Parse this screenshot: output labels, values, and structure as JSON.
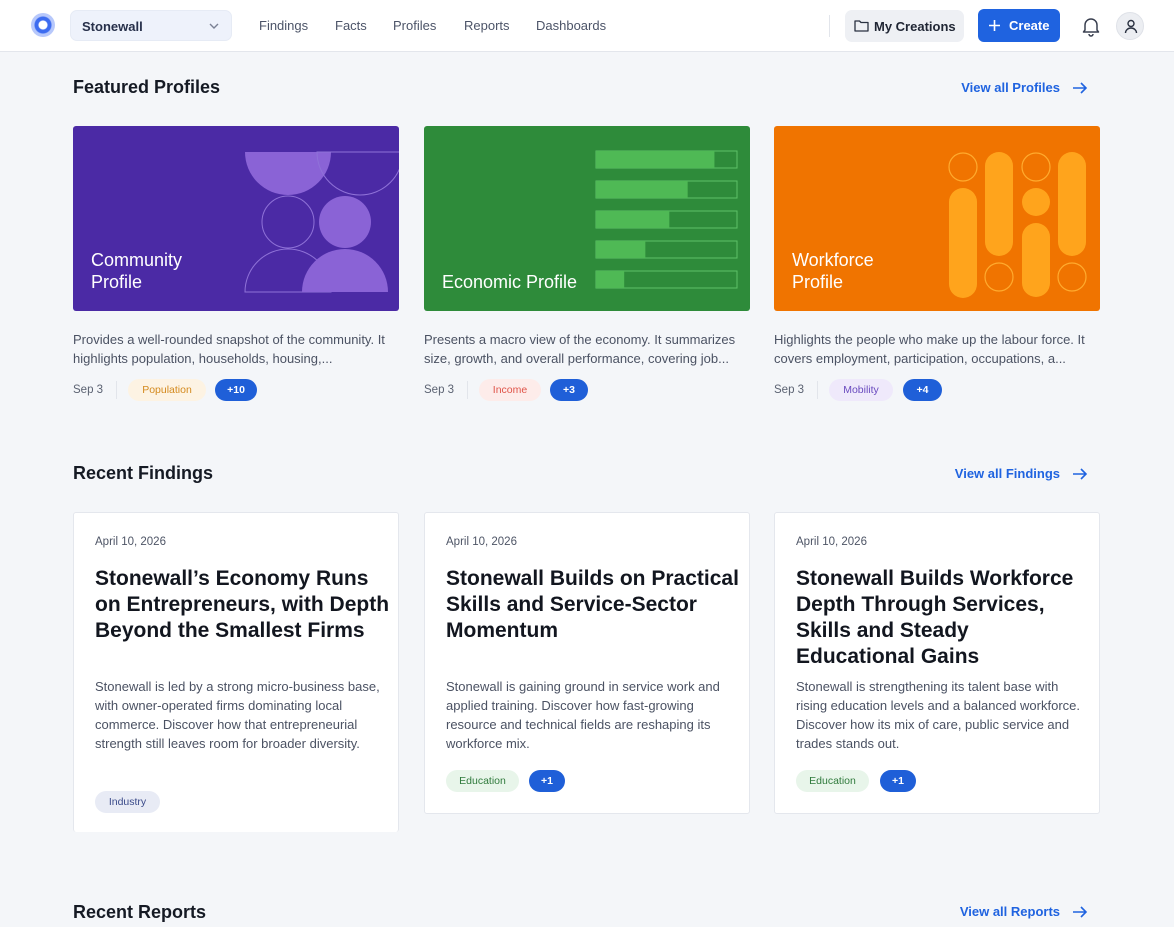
{
  "header": {
    "org_name": "Stonewall",
    "nav": [
      "Findings",
      "Facts",
      "Profiles",
      "Reports",
      "Dashboards"
    ],
    "my_creations_label": "My Creations",
    "create_label": "Create",
    "icons": [
      "logo-icon",
      "chevron-down-icon",
      "folder-icon",
      "plus-icon",
      "bell-icon",
      "user-icon"
    ]
  },
  "colors": {
    "accent": "#1f63e0",
    "community": "#4b2aa5",
    "economic": "#2e8b3a",
    "workforce": "#f07400"
  },
  "profiles": {
    "title": "Featured Profiles",
    "view_all": "View all Profiles",
    "items": [
      {
        "title": "Community\nProfile",
        "desc": "Provides a well-rounded snapshot of the community. It highlights population, households, housing,...",
        "date": "Sep 3",
        "tag": "Population",
        "count": "+10"
      },
      {
        "title": "Economic Profile",
        "desc": "Presents a macro view of the economy. It summarizes size, growth, and overall performance, covering job...",
        "date": "Sep 3",
        "tag": "Income",
        "count": "+3"
      },
      {
        "title": "Workforce\nProfile",
        "desc": "Highlights the people who make up the labour force. It covers employment, participation, occupations, a...",
        "date": "Sep 3",
        "tag": "Mobility",
        "count": "+4"
      }
    ]
  },
  "findings": {
    "title": "Recent Findings",
    "view_all": "View all Findings",
    "items": [
      {
        "date": "April 10, 2026",
        "title": "Stonewall’s Economy Runs on Entrepreneurs, with Depth Beyond the Smallest Firms",
        "body": "Stonewall is led by a strong micro-business base, with owner-operated firms dominating local commerce. Discover how that entrepreneurial strength still leaves room for broader diversity.",
        "tag": "Industry"
      },
      {
        "date": "April 10, 2026",
        "title": "Stonewall Builds on Practical Skills and Service-Sector Momentum",
        "body": "Stonewall is gaining ground in service work and applied training. Discover how fast-growing resource and technical fields are reshaping its workforce mix.",
        "tag": "Education",
        "count": "+1"
      },
      {
        "date": "April 10, 2026",
        "title": "Stonewall Builds Workforce Depth Through Services, Skills and Steady Educational Gains",
        "body": "Stonewall is strengthening its talent base with rising education levels and a balanced workforce. Discover how its mix of care, public service and trades stands out.",
        "tag": "Education",
        "count": "+1"
      }
    ]
  },
  "reports": {
    "title": "Recent Reports",
    "view_all": "View all Reports"
  }
}
